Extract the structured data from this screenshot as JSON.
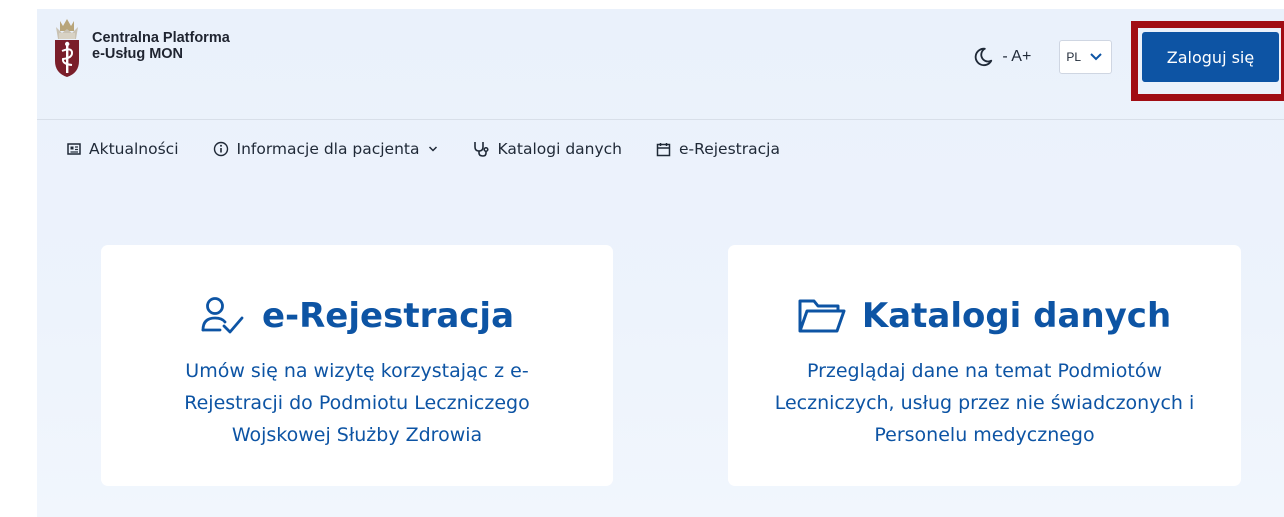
{
  "header": {
    "logo_line1": "Centralna Platforma",
    "logo_line2": "e-Usług MON",
    "font_size_label": "- A+",
    "language": "PL",
    "login_label": "Zaloguj się"
  },
  "nav": {
    "items": [
      {
        "label": "Aktualności",
        "icon": "newspaper-icon"
      },
      {
        "label": "Informacje dla pacjenta",
        "icon": "info-icon"
      },
      {
        "label": "Katalogi danych",
        "icon": "stethoscope-icon"
      },
      {
        "label": "e-Rejestracja",
        "icon": "calendar-icon"
      }
    ]
  },
  "cards": [
    {
      "title": "e-Rejestracja",
      "icon": "user-check-icon",
      "description": "Umów się na wizytę korzystając z e-Rejestracji do Podmiotu Leczniczego Wojskowej Służby Zdrowia"
    },
    {
      "title": "Katalogi danych",
      "icon": "folder-icon",
      "description": "Przeglądaj dane na temat Podmiotów Leczniczych, usług przez nie świadczonych i Personelu medycznego"
    }
  ],
  "colors": {
    "brand": "#0d54a4",
    "highlight": "#a10d14",
    "background": "#eaf1fb"
  }
}
